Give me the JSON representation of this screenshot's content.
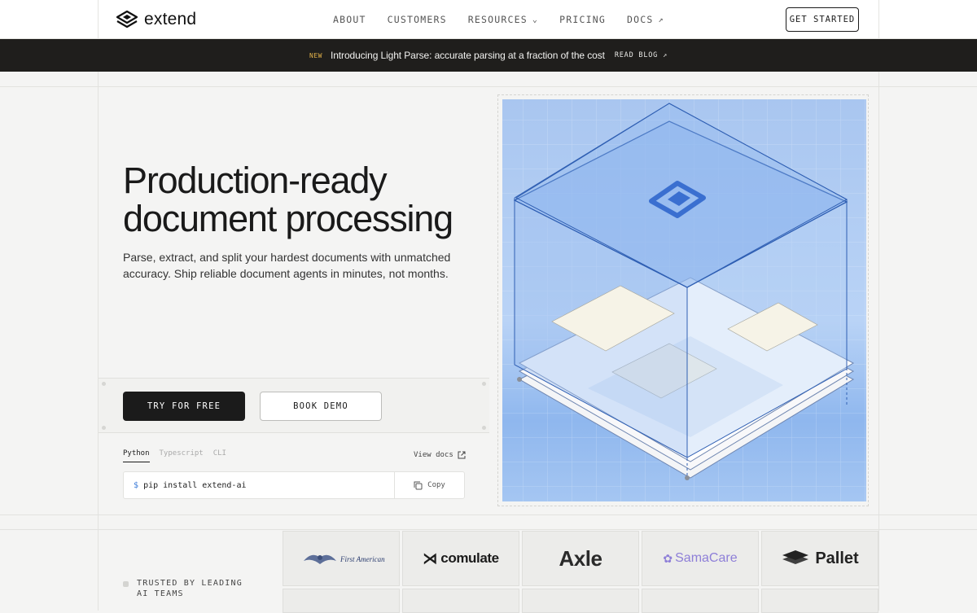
{
  "nav": {
    "brand": "extend",
    "items": [
      {
        "label": "ABOUT"
      },
      {
        "label": "CUSTOMERS"
      },
      {
        "label": "RESOURCES"
      },
      {
        "label": "PRICING"
      },
      {
        "label": "DOCS"
      }
    ],
    "cta": "GET STARTED"
  },
  "banner": {
    "badge": "NEW",
    "text": "Introducing Light Parse: accurate parsing at a fraction of the cost",
    "link": "READ BLOG"
  },
  "hero": {
    "title_line1": "Production-ready",
    "title_line2": "document processing",
    "subtitle": "Parse, extract, and split your hardest documents with unmatched accuracy. Ship reliable document agents in minutes, not months.",
    "primary_cta": "TRY FOR FREE",
    "secondary_cta": "BOOK DEMO",
    "code_tabs": [
      "Python",
      "Typescript",
      "CLI"
    ],
    "active_tab": "Python",
    "view_docs": "View docs",
    "prompt": "$",
    "command": "pip install extend-ai",
    "copy_label": "Copy"
  },
  "trusted": {
    "line1": "TRUSTED BY LEADING",
    "line2": "AI TEAMS",
    "logos": [
      "First American",
      "comulate",
      "Axle",
      "SamaCare",
      "Pallet"
    ]
  },
  "colors": {
    "accent_blue": "#3b7bd8",
    "banner_bg": "#1f1e1c",
    "badge_gold": "#e2b24a"
  }
}
